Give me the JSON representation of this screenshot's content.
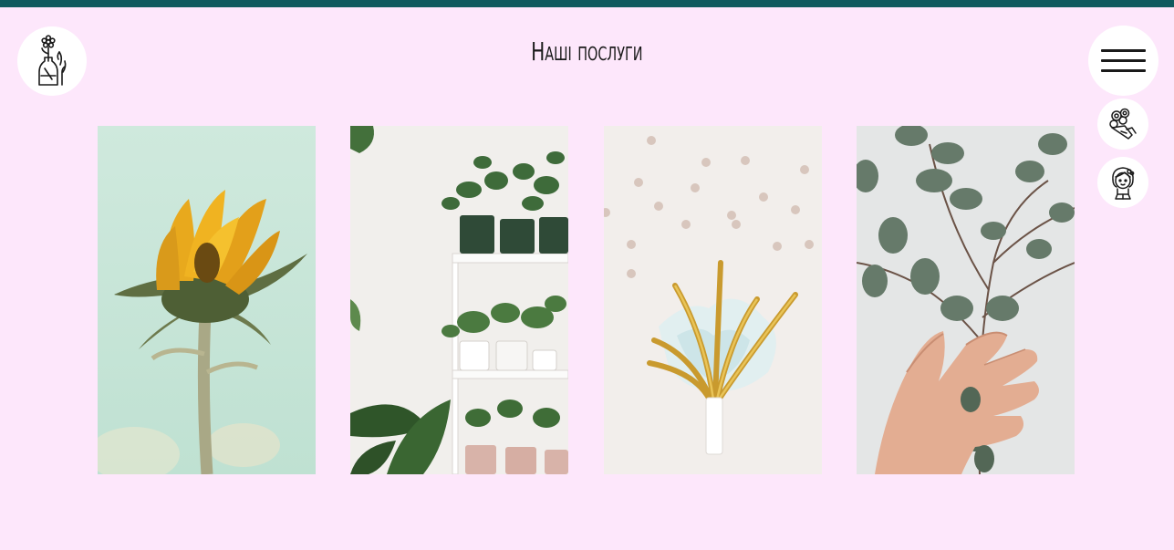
{
  "header": {
    "title": "Наші послуги",
    "logo_icon": "flowers-in-vase-icon",
    "menu_icon": "hamburger-menu-icon"
  },
  "side_nav": [
    {
      "icon": "bouquet-icon"
    },
    {
      "icon": "florist-girl-icon"
    }
  ],
  "gallery": [
    {
      "name": "sunflower",
      "icon": "sunflower-photo"
    },
    {
      "name": "plant-shelf",
      "icon": "potted-plants-photo"
    },
    {
      "name": "gift-ribbon",
      "icon": "golden-ribbon-photo"
    },
    {
      "name": "eucalyptus-hand",
      "icon": "eucalyptus-hand-photo"
    }
  ],
  "colors": {
    "background": "#fde7fb",
    "top_bar": "#0f5a5e",
    "button_bg": "#ffffff",
    "text": "#1a1a1a"
  }
}
